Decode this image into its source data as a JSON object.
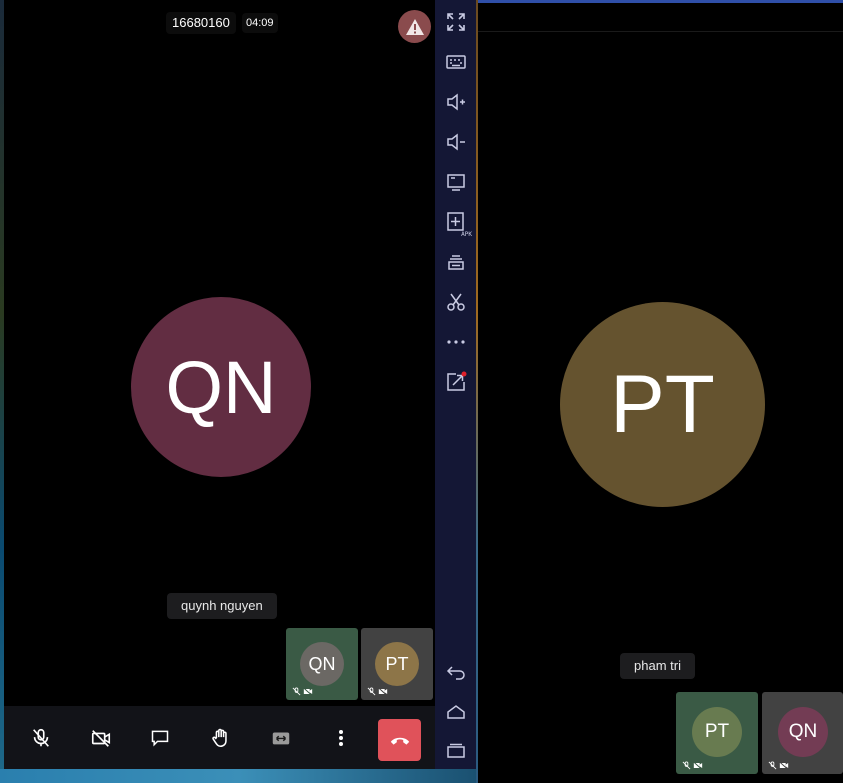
{
  "left_window": {
    "meeting_id": "16680160",
    "timer": "04:09",
    "main_participant": {
      "initials": "QN",
      "name": "quynh nguyen",
      "color": "#622d42"
    },
    "thumbnails": [
      {
        "initials": "QN",
        "tile_color": "#3a5a45",
        "avatar_color": "#6b6864"
      },
      {
        "initials": "PT",
        "tile_color": "#424242",
        "avatar_color": "#8d7548"
      }
    ],
    "controls": [
      "mic-off-icon",
      "camera-off-icon",
      "chat-icon",
      "raise-hand-icon",
      "switch-camera-icon",
      "more-icon",
      "end-call-icon"
    ]
  },
  "toolbar": {
    "items": [
      "fullscreen-icon",
      "keyboard-icon",
      "volume-up-icon",
      "volume-down-icon",
      "screen-icon",
      "apk-install-icon",
      "layers-icon",
      "screenshot-scissors-icon",
      "more-horizontal-icon",
      "share-external-icon",
      "back-icon",
      "home-icon",
      "recents-icon"
    ],
    "apk_label": "APK"
  },
  "right_window": {
    "main_participant": {
      "initials": "PT",
      "name": "pham tri",
      "color": "#65532f"
    },
    "thumbnails": [
      {
        "initials": "PT",
        "tile_color": "#3a5a45",
        "avatar_color": "#687b50"
      },
      {
        "initials": "QN",
        "tile_color": "#424242",
        "avatar_color": "#733c54"
      }
    ]
  }
}
